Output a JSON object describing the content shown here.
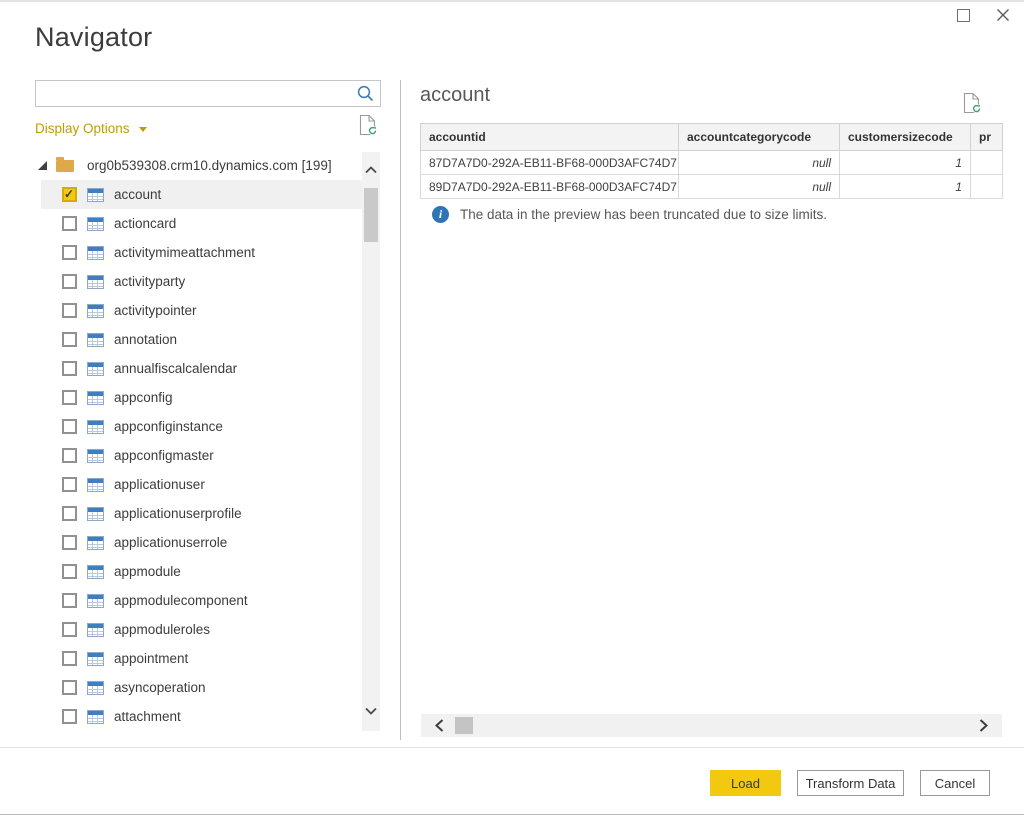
{
  "window": {
    "title": "Navigator"
  },
  "left_pane": {
    "search": {
      "value": "",
      "placeholder": ""
    },
    "display_options_label": "Display Options",
    "tree": {
      "root_label": "org0b539308.crm10.dynamics.com [199]",
      "items": [
        {
          "label": "account",
          "checked": true,
          "selected": true
        },
        {
          "label": "actioncard",
          "checked": false,
          "selected": false
        },
        {
          "label": "activitymimeattachment",
          "checked": false,
          "selected": false
        },
        {
          "label": "activityparty",
          "checked": false,
          "selected": false
        },
        {
          "label": "activitypointer",
          "checked": false,
          "selected": false
        },
        {
          "label": "annotation",
          "checked": false,
          "selected": false
        },
        {
          "label": "annualfiscalcalendar",
          "checked": false,
          "selected": false
        },
        {
          "label": "appconfig",
          "checked": false,
          "selected": false
        },
        {
          "label": "appconfiginstance",
          "checked": false,
          "selected": false
        },
        {
          "label": "appconfigmaster",
          "checked": false,
          "selected": false
        },
        {
          "label": "applicationuser",
          "checked": false,
          "selected": false
        },
        {
          "label": "applicationuserprofile",
          "checked": false,
          "selected": false
        },
        {
          "label": "applicationuserrole",
          "checked": false,
          "selected": false
        },
        {
          "label": "appmodule",
          "checked": false,
          "selected": false
        },
        {
          "label": "appmodulecomponent",
          "checked": false,
          "selected": false
        },
        {
          "label": "appmoduleroles",
          "checked": false,
          "selected": false
        },
        {
          "label": "appointment",
          "checked": false,
          "selected": false
        },
        {
          "label": "asyncoperation",
          "checked": false,
          "selected": false
        },
        {
          "label": "attachment",
          "checked": false,
          "selected": false
        }
      ]
    }
  },
  "preview": {
    "title": "account",
    "table": {
      "columns": [
        "accountid",
        "accountcategorycode",
        "customersizecode",
        "pr"
      ],
      "rows": [
        [
          "87D7A7D0-292A-EB11-BF68-000D3AFC74D7",
          "null",
          "1",
          ""
        ],
        [
          "89D7A7D0-292A-EB11-BF68-000D3AFC74D7",
          "null",
          "1",
          ""
        ]
      ]
    },
    "notice": "The data in the preview has been truncated due to size limits."
  },
  "footer": {
    "load_label": "Load",
    "transform_label": "Transform Data",
    "cancel_label": "Cancel"
  },
  "colors": {
    "accent_yellow": "#f2c811",
    "display_options_text": "#c19c00",
    "info_icon": "#2e75b6",
    "table_icon_header": "#3f7fc1",
    "selected_row_bg": "#f0f0f0"
  }
}
